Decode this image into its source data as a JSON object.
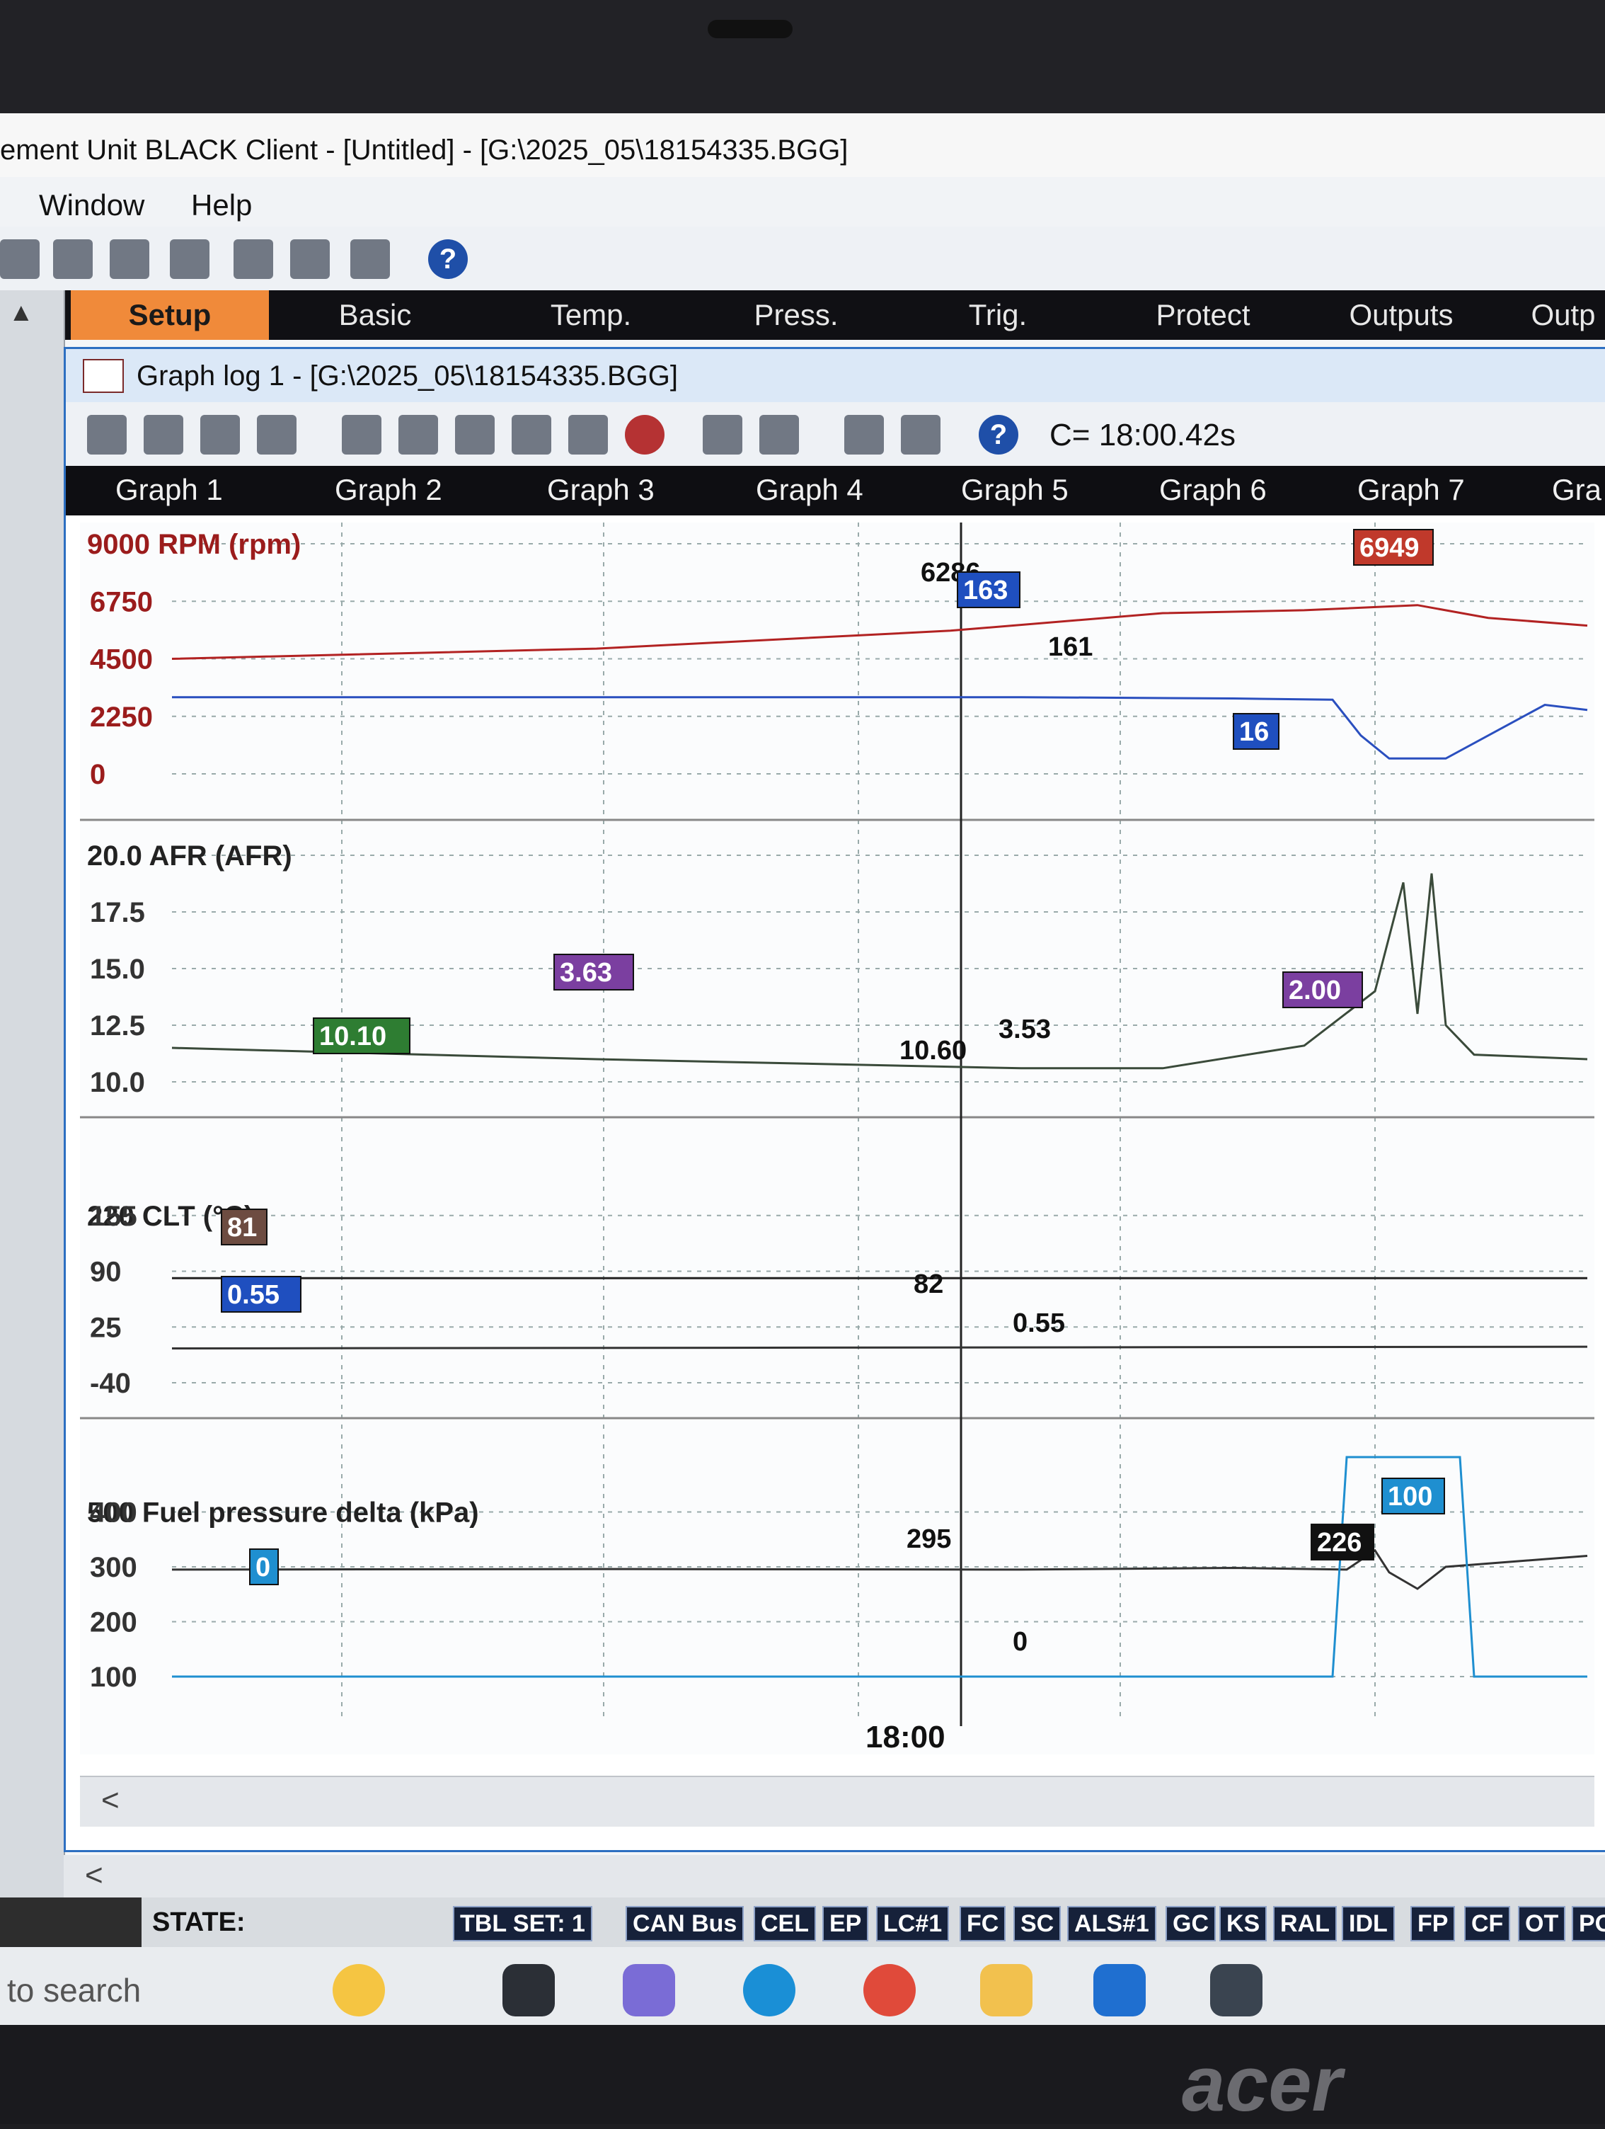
{
  "window": {
    "title": "ement Unit BLACK Client - [Untitled]    - [G:\\2025_05\\18154335.BGG]"
  },
  "menu": [
    "Window",
    "Help"
  ],
  "tabs": [
    "Setup",
    "Basic",
    "Temp.",
    "Press.",
    "Trig.",
    "Protect",
    "Outputs",
    "Outp"
  ],
  "graph_window": {
    "title": "Graph log 1 - [G:\\2025_05\\18154335.BGG]",
    "cursor": "C= 18:00.42s",
    "graph_tabs": [
      "Graph 1",
      "Graph 2",
      "Graph 3",
      "Graph 4",
      "Graph 5",
      "Graph 6",
      "Graph 7",
      "Gra"
    ]
  },
  "chart_data": [
    {
      "type": "line",
      "ylabel": "9000 RPM (rpm)",
      "yticks": [
        "9000",
        "6750",
        "4500",
        "2250",
        "0"
      ],
      "ylim": [
        0,
        9000
      ],
      "series": [
        {
          "color": "#b22222",
          "x": [
            0,
            0.3,
            0.55,
            0.7,
            0.8,
            0.88,
            0.93,
            1.0
          ],
          "y": [
            4500,
            4900,
            5600,
            6286,
            6400,
            6600,
            6100,
            5800
          ]
        },
        {
          "color": "#2a4fbf",
          "x": [
            0,
            0.3,
            0.6,
            0.75,
            0.82,
            0.84,
            0.86,
            0.9,
            0.97,
            1.0
          ],
          "y": [
            3000,
            3000,
            3000,
            2950,
            2900,
            1500,
            600,
            600,
            2700,
            2500
          ]
        }
      ],
      "labels": [
        "6286",
        "163",
        "161",
        "6949",
        "16"
      ]
    },
    {
      "type": "line",
      "ylabel": "20.0 AFR (AFR)",
      "yticks": [
        "20.0",
        "17.5",
        "15.0",
        "12.5",
        "10.0"
      ],
      "ylim": [
        10,
        20
      ],
      "series": [
        {
          "color": "#3a4a3a",
          "x": [
            0,
            0.3,
            0.6,
            0.7,
            0.8,
            0.85,
            0.87,
            0.88,
            0.89,
            0.9,
            0.92,
            1.0
          ],
          "y": [
            11.5,
            11.0,
            10.6,
            10.6,
            11.6,
            14.0,
            18.8,
            13.0,
            19.2,
            12.5,
            11.2,
            11.0
          ]
        }
      ],
      "labels": [
        "10.10",
        "3.63",
        "10.60",
        "3.53",
        "2.00"
      ]
    },
    {
      "type": "line",
      "ylabel": "220 CLT (°C)",
      "yticks": [
        "155",
        "90",
        "25",
        "-40"
      ],
      "ylim": [
        -40,
        220
      ],
      "series": [
        {
          "color": "#222222",
          "x": [
            0,
            1.0
          ],
          "y": [
            82,
            82
          ]
        },
        {
          "color": "#333333",
          "x": [
            0,
            1.0
          ],
          "y": [
            0,
            2
          ]
        }
      ],
      "labels": [
        "81",
        "0.55",
        "82",
        "0.55"
      ]
    },
    {
      "type": "line",
      "ylabel": "500 Fuel pressure delta (kPa)",
      "yticks": [
        "400",
        "300",
        "200",
        "100"
      ],
      "ylim": [
        100,
        500
      ],
      "xlabel": "18:00",
      "series": [
        {
          "color": "#333333",
          "x": [
            0,
            0.3,
            0.6,
            0.75,
            0.83,
            0.85,
            0.86,
            0.88,
            0.9,
            1.0
          ],
          "y": [
            295,
            296,
            295,
            298,
            295,
            330,
            290,
            260,
            300,
            320
          ]
        },
        {
          "color": "#1f8fd0",
          "x": [
            0,
            0.82,
            0.83,
            0.91,
            0.92,
            1.0
          ],
          "y": [
            100,
            100,
            500,
            500,
            100,
            100
          ]
        }
      ],
      "labels": [
        "0",
        "295",
        "0",
        "100",
        "226"
      ]
    }
  ],
  "status": {
    "state_label": "STATE:",
    "flags": [
      "TBL SET: 1",
      "CAN Bus",
      "CEL",
      "EP",
      "LC#1",
      "FC",
      "SC",
      "ALS#1",
      "GC",
      "KS",
      "RAL",
      "IDL",
      "FP",
      "CF",
      "OT",
      "PO"
    ]
  },
  "taskbar": {
    "search": "to search"
  },
  "brand": "acer"
}
